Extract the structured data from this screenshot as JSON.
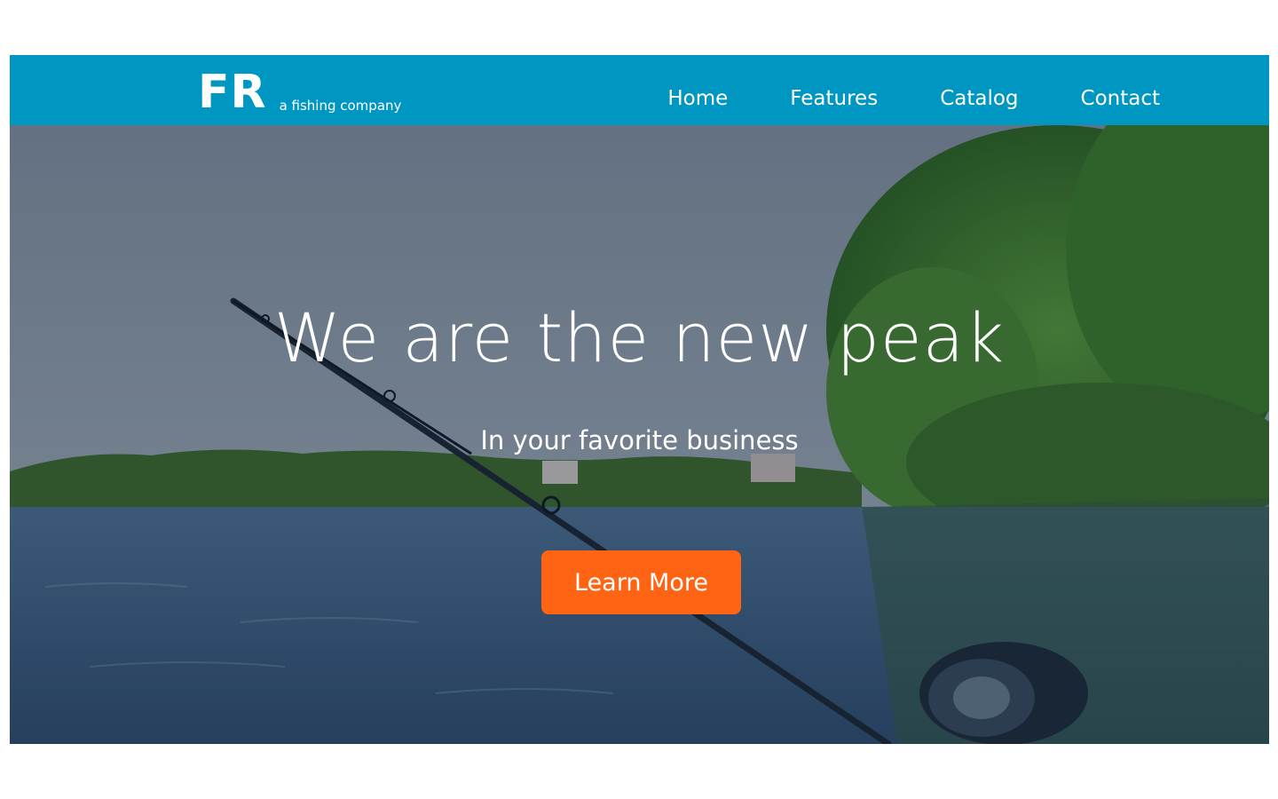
{
  "brand": {
    "mark": "FR",
    "tagline": "a fishing company"
  },
  "nav": {
    "items": [
      {
        "label": "Home"
      },
      {
        "label": "Features"
      },
      {
        "label": "Catalog"
      },
      {
        "label": "Contact"
      }
    ]
  },
  "hero": {
    "headline": "We are the new peak",
    "subheadline": "In your favorite business",
    "cta_label": "Learn More"
  },
  "colors": {
    "navbar": "#0096c2",
    "cta": "#ff6414",
    "text": "#ffffff"
  }
}
